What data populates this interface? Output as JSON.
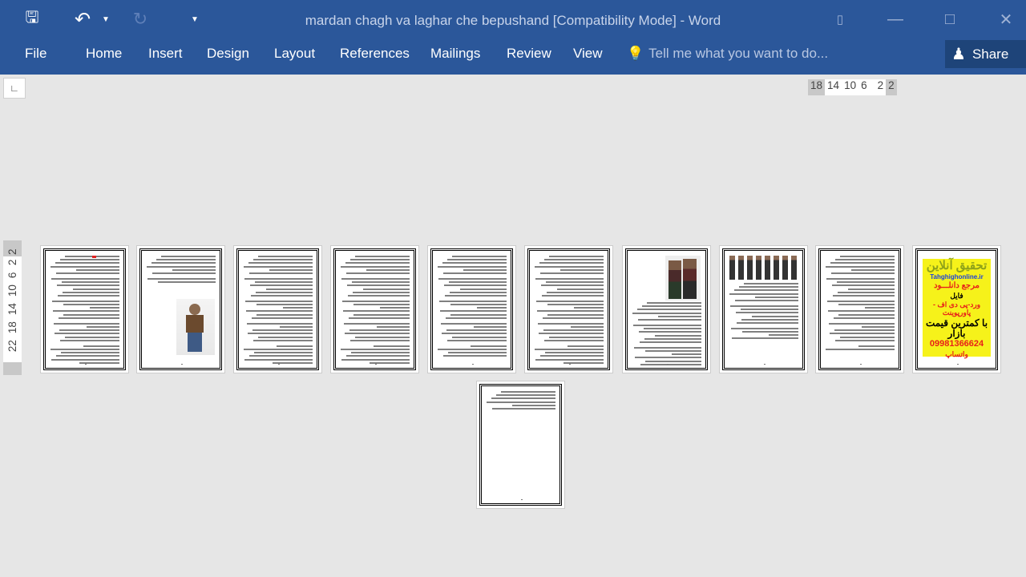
{
  "window": {
    "title": "mardan chagh va laghar che bepushand [Compatibility Mode] - Word",
    "controls": [
      "ribbon-display-options",
      "minimize",
      "maximize",
      "close"
    ]
  },
  "quick_access": {
    "save": "save-icon",
    "undo": "undo-icon",
    "redo": "redo-icon",
    "customize": "customize-icon"
  },
  "ribbon": {
    "tabs": [
      "File",
      "Home",
      "Insert",
      "Design",
      "Layout",
      "References",
      "Mailings",
      "Review",
      "View"
    ],
    "tell_me": "Tell me what you want to do...",
    "share": "Share"
  },
  "ruler": {
    "horizontal": [
      "18",
      "14",
      "10",
      "6",
      "2",
      "2"
    ],
    "vertical": [
      "2",
      "2",
      "6",
      "10",
      "14",
      "18",
      "22"
    ]
  },
  "pages": [
    {
      "n": 1,
      "lines": 34,
      "mark": true
    },
    {
      "n": 2,
      "lines": 8,
      "image": "man-standing"
    },
    {
      "n": 3,
      "lines": 30
    },
    {
      "n": 4,
      "lines": 30
    },
    {
      "n": 5,
      "lines": 28
    },
    {
      "n": 6,
      "lines": 30
    },
    {
      "n": 7,
      "lines": 18,
      "image": "two-men"
    },
    {
      "n": 8,
      "lines": 16,
      "image": "group-of-men"
    },
    {
      "n": 9,
      "lines": 26
    },
    {
      "n": 10,
      "ad": {
        "title": "تحقیق آنلاین",
        "site": "Tahghighonline.ir",
        "l1": "مرجع دانلـــود",
        "l2": "فایل",
        "l3": "ورد-پی دی اف - پاورپوینت",
        "l4": "با کمترین قیمت بازار",
        "phone": "09981366624",
        "l5": "واتساپ"
      },
      "colors": {
        "bg": "#f6f21a",
        "title": "#8fa21a",
        "red": "#e8201a",
        "blue": "#1a3fe0"
      }
    },
    {
      "n": 11,
      "lines": 6
    }
  ]
}
